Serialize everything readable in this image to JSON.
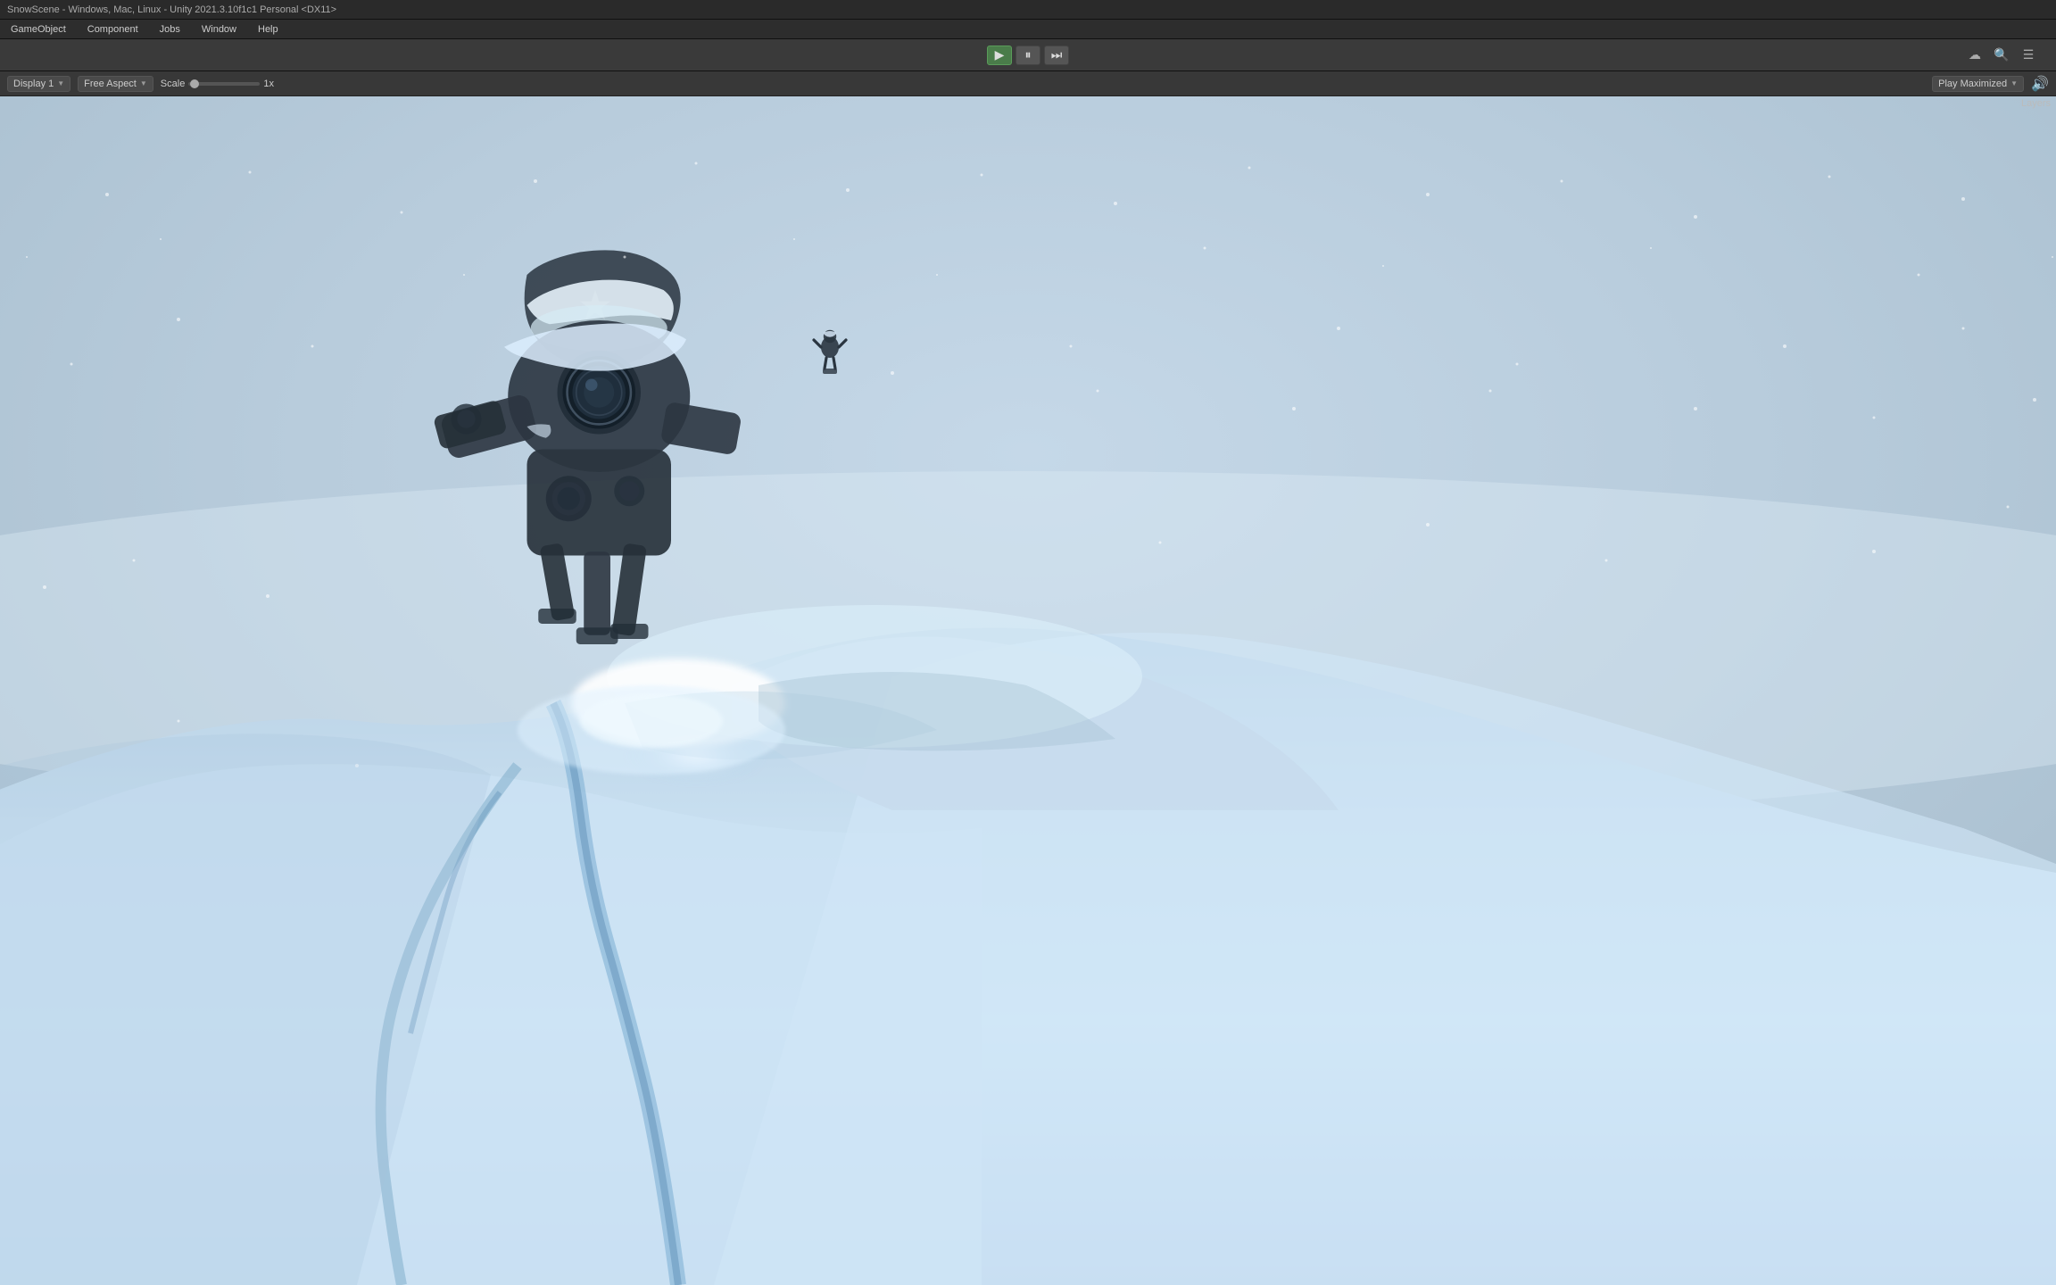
{
  "titlebar": {
    "text": "SnowScene - Windows, Mac, Linux - Unity 2021.3.10f1c1 Personal <DX11>"
  },
  "menubar": {
    "items": [
      "GameObject",
      "Component",
      "Jobs",
      "Window",
      "Help"
    ]
  },
  "toolbar": {
    "play_label": "▶",
    "pause_label": "⏸",
    "step_label": "⏭",
    "search_icon": "🔍",
    "layers_icon": "☰"
  },
  "game_toolbar": {
    "display_label": "Display 1",
    "aspect_label": "Free Aspect",
    "scale_label": "Scale",
    "scale_value": "1x",
    "play_maximized_label": "Play Maximized",
    "layers_label": "Layers",
    "mute_icon": "🔊"
  },
  "viewport": {
    "layers_text": "Layers"
  },
  "colors": {
    "sky_top": "#b5c8d8",
    "sky_bottom": "#e8eef4",
    "snow_light": "#d8eef8",
    "snow_mid": "#c0d8ec",
    "accent_glow": "#f0f8ff",
    "snow_shadow": "#a8c4dc"
  }
}
